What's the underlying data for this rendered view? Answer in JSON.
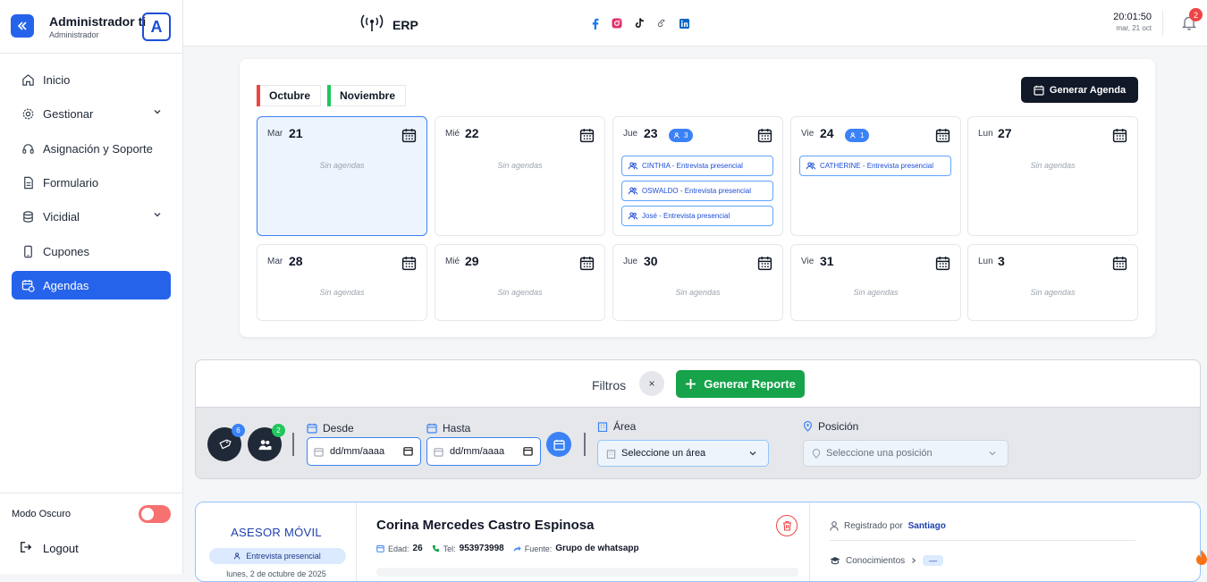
{
  "sidebar": {
    "user_name": "Administrador ti",
    "user_role": "Administrador",
    "avatar_letter": "A",
    "items": [
      {
        "label": "Inicio",
        "icon": "home-icon"
      },
      {
        "label": "Gestionar",
        "icon": "gear-icon",
        "expandable": true
      },
      {
        "label": "Asignación y Soporte",
        "icon": "headset-icon"
      },
      {
        "label": "Formulario",
        "icon": "document-icon"
      },
      {
        "label": "Vicidial",
        "icon": "database-icon",
        "expandable": true
      },
      {
        "label": "Cupones",
        "icon": "phone-icon"
      },
      {
        "label": "Agendas",
        "icon": "calendar-clock-icon",
        "active": true
      }
    ],
    "dark_mode_label": "Modo Oscuro",
    "logout_label": "Logout"
  },
  "topbar": {
    "app_name": "ERP",
    "time": "20:01:50",
    "date": "mar, 21 oct",
    "notification_count": "2"
  },
  "calendar": {
    "month_tabs": [
      "Octubre",
      "Noviembre"
    ],
    "generate_label": "Generar Agenda",
    "empty_label": "Sin agendas",
    "days": [
      {
        "dow": "Mar",
        "num": "21",
        "selected": true,
        "count": "",
        "appointments": []
      },
      {
        "dow": "Mié",
        "num": "22",
        "count": "",
        "appointments": []
      },
      {
        "dow": "Jue",
        "num": "23",
        "count": "3",
        "appointments": [
          "CINTHIA - Entrevista presencial",
          "OSWALDO - Entrevista presencial",
          "José - Entrevista presencial"
        ]
      },
      {
        "dow": "Vie",
        "num": "24",
        "count": "1",
        "appointments": [
          "CATHERINE - Entrevista presencial"
        ]
      },
      {
        "dow": "Lun",
        "num": "27",
        "count": "",
        "appointments": []
      },
      {
        "dow": "Mar",
        "num": "28",
        "count": "",
        "appointments": []
      },
      {
        "dow": "Mié",
        "num": "29",
        "count": "",
        "appointments": []
      },
      {
        "dow": "Jue",
        "num": "30",
        "count": "",
        "appointments": []
      },
      {
        "dow": "Vie",
        "num": "31",
        "count": "",
        "appointments": []
      },
      {
        "dow": "Lun",
        "num": "3",
        "count": "",
        "appointments": []
      }
    ]
  },
  "filters": {
    "title": "Filtros",
    "close": "×",
    "report_label": "Generar Reporte",
    "badge_tags": "6",
    "badge_users": "2",
    "desde_label": "Desde",
    "hasta_label": "Hasta",
    "date_placeholder": "dd/mm/aaaa",
    "area_label": "Área",
    "area_placeholder": "Seleccione un área",
    "posicion_label": "Posición",
    "posicion_placeholder": "Seleccione una posición"
  },
  "record": {
    "role": "ASESOR MÓVIL",
    "type": "Entrevista presencial",
    "date": "lunes, 2 de octubre de 2025",
    "name": "Corina Mercedes Castro Espinosa",
    "age_label": "Edad:",
    "age": "26",
    "tel_label": "Tel:",
    "tel": "953973998",
    "source_label": "Fuente:",
    "source": "Grupo de whatsapp",
    "registered_label": "Registrado por",
    "registered_by": "Santiago",
    "knowledge_label": "Conocimientos",
    "knowledge_value": "—"
  },
  "colors": {
    "accent": "#2563eb",
    "dark": "#111827",
    "green": "#16a34a",
    "danger": "#ef4444"
  }
}
